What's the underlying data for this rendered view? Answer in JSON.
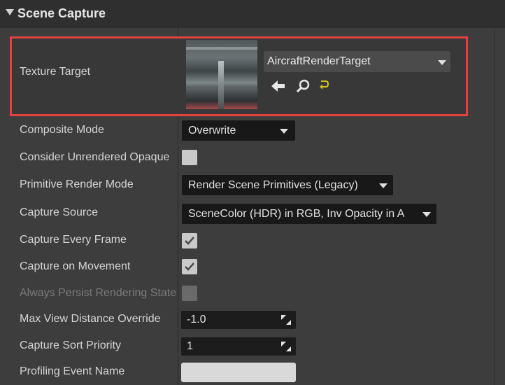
{
  "section": {
    "title": "Scene Capture",
    "expand_icon": "triangle-down-icon"
  },
  "texture_target": {
    "label": "Texture Target",
    "asset_name": "AircraftRenderTarget",
    "icons": [
      "use-selected-arrow-icon",
      "browse-search-icon",
      "reset-yellow-arrow-icon"
    ],
    "highlight_color": "#e4413f"
  },
  "composite_mode": {
    "label": "Composite Mode",
    "value": "Overwrite"
  },
  "consider_unrendered": {
    "label": "Consider Unrendered Opaque",
    "checked": false
  },
  "primitive_render_mode": {
    "label": "Primitive Render Mode",
    "value": "Render Scene Primitives (Legacy)"
  },
  "capture_source": {
    "label": "Capture Source",
    "value": "SceneColor (HDR) in RGB, Inv Opacity in A"
  },
  "capture_every_frame": {
    "label": "Capture Every Frame",
    "checked": true
  },
  "capture_on_movement": {
    "label": "Capture on Movement",
    "checked": true
  },
  "always_persist": {
    "label": "Always Persist Rendering State",
    "checked": false,
    "disabled": true
  },
  "max_view_distance": {
    "label": "Max View Distance Override",
    "value": "-1.0"
  },
  "capture_sort_priority": {
    "label": "Capture Sort Priority",
    "value": "1"
  },
  "profiling_event_name": {
    "label": "Profiling Event Name",
    "value": ""
  },
  "colors": {
    "panel_bg": "#3d3d3d",
    "header_bg": "#2f2f2f",
    "field_bg": "#181818"
  }
}
